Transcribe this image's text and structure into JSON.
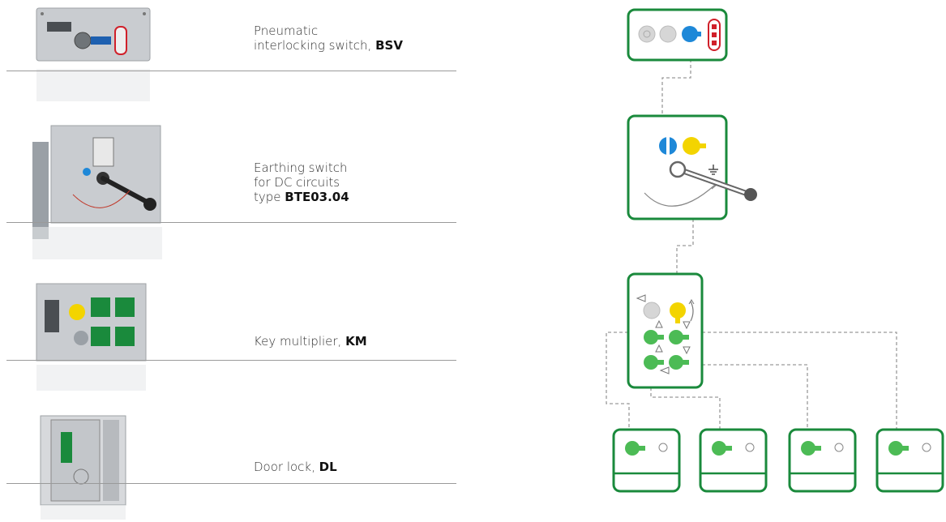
{
  "products": [
    {
      "line1": "Pneumatic",
      "line2": "interlocking switch, ",
      "code": "BSV"
    },
    {
      "line1": "Earthing switch",
      "line2": "for DC circuits",
      "line3": "type ",
      "code": "BTE03.04"
    },
    {
      "line1": "Key multiplier, ",
      "code": "KM"
    },
    {
      "line1": "Door lock, ",
      "code": "DL"
    }
  ],
  "colors": {
    "green": "#1a8a3c",
    "lightgreen": "#4cbb55",
    "blue": "#1e88d8",
    "yellow": "#f3d400",
    "grey": "#bbbbbb",
    "red": "#d0202a"
  }
}
